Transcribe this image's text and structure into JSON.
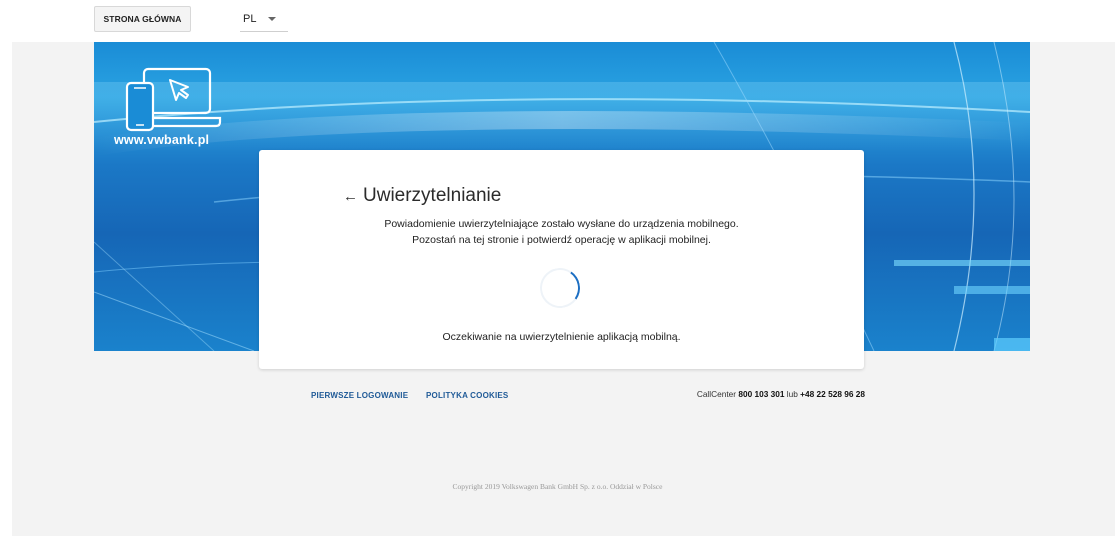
{
  "header": {
    "home_label": "STRONA GŁÓWNA",
    "language": "PL"
  },
  "hero": {
    "logo_text": "www.vwbank.pl"
  },
  "auth": {
    "title": "Uwierzytelnianie",
    "back_icon": "arrow-left-icon",
    "message_line1": "Powiadomienie uwierzytelniające zostało wysłane do urządzenia mobilnego.",
    "message_line2": "Pozostań na tej stronie i potwierdź operację w aplikacji mobilnej.",
    "waiting_text": "Oczekiwanie na uwierzytelnienie aplikacją mobilną."
  },
  "footer": {
    "link_first_login": "PIERWSZE LOGOWANIE",
    "link_cookies": "POLITYKA COOKIES",
    "callcenter_label": "CallCenter ",
    "callcenter_number1": "800 103 301",
    "callcenter_or": " lub ",
    "callcenter_number2": "+48 22 528 96 28",
    "copyright": "Copyright 2019 Volkswagen Bank GmbH Sp. z o.o. Oddział w Polsce"
  },
  "colors": {
    "accent": "#1d6fc3",
    "link": "#1f5a97",
    "hero_blue": "#1a82cc",
    "page_bg": "#f3f3f3"
  }
}
